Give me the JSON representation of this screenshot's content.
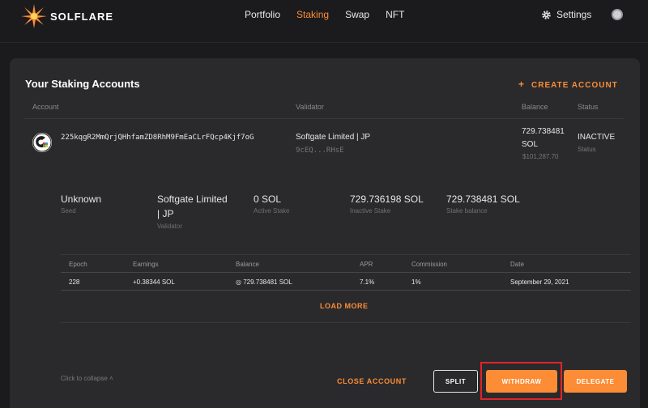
{
  "brand": {
    "name": "SOLFLARE",
    "accent": "#fc8c35"
  },
  "nav": {
    "items": [
      "Portfolio",
      "Staking",
      "Swap",
      "NFT"
    ],
    "active": "Staking"
  },
  "settings_label": "Settings",
  "panel": {
    "title": "Your Staking Accounts",
    "create_label": "CREATE ACCOUNT"
  },
  "columns": {
    "account": "Account",
    "validator": "Validator",
    "balance": "Balance",
    "status": "Status"
  },
  "account": {
    "address": "225kqgR2MmQrjQHhfamZD8RhM9FmEaCLrFQcp4Kjf7oG",
    "validator_name": "Softgate Limited | JP",
    "validator_addr": "9cEQ...RHsE",
    "balance_line1": "729.738481",
    "balance_line2": "SOL",
    "balance_usd": "$101,287.70",
    "status": "INACTIVE",
    "status_label": "Status"
  },
  "details": {
    "seed_value": "Unknown",
    "seed_label": "Seed",
    "validator_line1": "Softgate Limited",
    "validator_line2": "| JP",
    "validator_label": "Validator",
    "active_value": "0 SOL",
    "active_label": "Active Stake",
    "inactive_value": "729.736198 SOL",
    "inactive_label": "Inactive Stake",
    "stake_value": "729.738481 SOL",
    "stake_label": "Stake balance"
  },
  "epoch_table": {
    "headers": [
      "Epoch",
      "Earnings",
      "Balance",
      "APR",
      "Commission",
      "Date"
    ],
    "row": {
      "epoch": "228",
      "earnings": "+0.38344 SOL",
      "balance": "◎ 729.738481 SOL",
      "apr": "7.1%",
      "commission": "1%",
      "date": "September 29, 2021"
    },
    "load_more": "LOAD MORE"
  },
  "footer": {
    "collapse": "Click to collapse ˄",
    "close_account": "CLOSE ACCOUNT",
    "split": "SPLIT",
    "withdraw": "WITHDRAW",
    "delegate": "DELEGATE"
  }
}
